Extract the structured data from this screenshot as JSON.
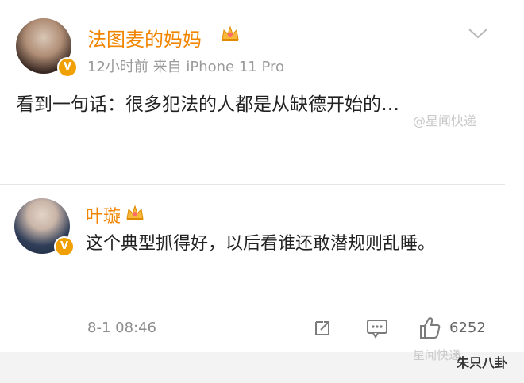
{
  "post": {
    "username": "法图麦的妈妈",
    "meta": "12小时前  来自 iPhone 11 Pro",
    "text": "看到一句话：很多犯法的人都是从缺德开始的…"
  },
  "watermark_top": "@星闻快递",
  "comment": {
    "username": "叶璇",
    "text": "这个典型抓得好，以后看谁还敢潜规则乱睡。",
    "date": "8-1 08:46",
    "like_count": "6252"
  },
  "watermark_bottom": "星闻快递",
  "watermark_bottom_sub": "朱只八卦",
  "badges": {
    "verified": "V"
  },
  "colors": {
    "username": "#f18500",
    "badge": "#f0a000",
    "meta": "#9a9a9a"
  },
  "icons": [
    "crown-icon",
    "chevron-down-icon",
    "share-icon",
    "comment-icon",
    "like-icon"
  ]
}
